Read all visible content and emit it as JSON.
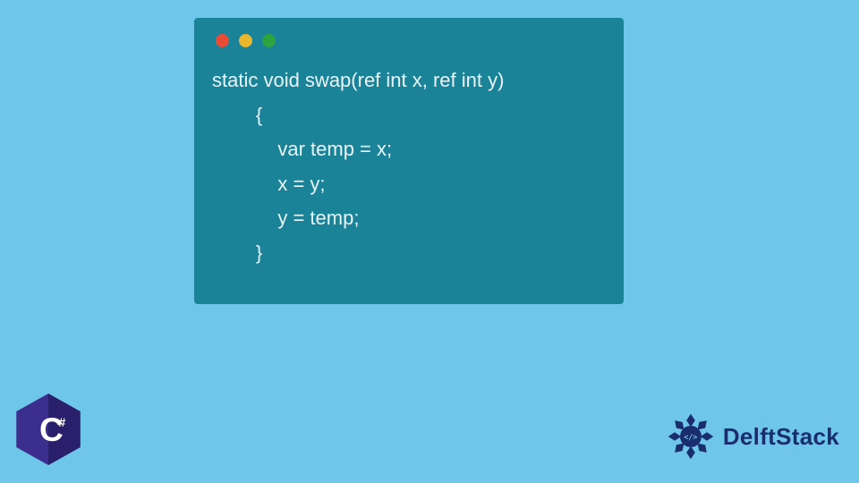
{
  "window": {
    "dots": [
      "red",
      "yellow",
      "green"
    ]
  },
  "code": {
    "line1": "static void swap(ref int x, ref int y)",
    "line2": "        {",
    "line3": "            var temp = x;",
    "line4": "            x = y;",
    "line5": "            y = temp;",
    "line6": "        }"
  },
  "branding": {
    "delft_text": "DelftStack",
    "csharp_label": "C#"
  },
  "colors": {
    "page_bg": "#6ec6ea",
    "window_bg": "#1a8398",
    "code_text": "#e8f4f8",
    "csharp_purple": "#3b2e8c",
    "delft_navy": "#1a2d6e"
  }
}
